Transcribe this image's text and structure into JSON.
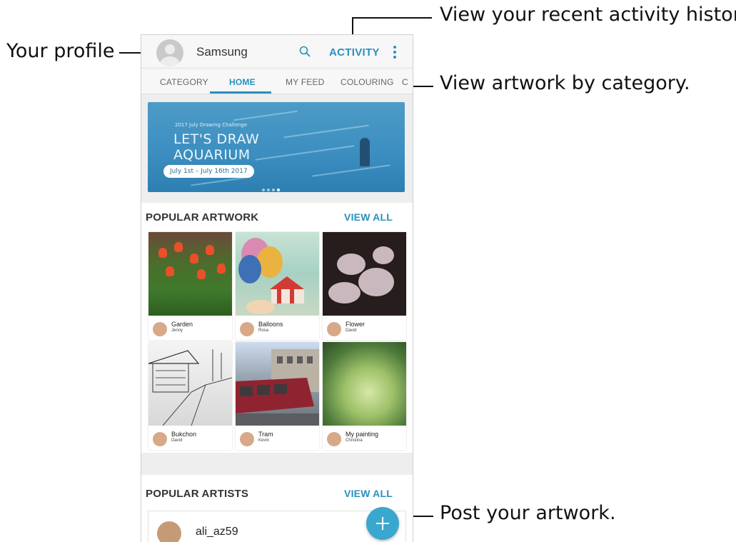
{
  "callouts": {
    "profile": "Your profile",
    "activity": "View your recent activity history.",
    "category": "View artwork by category.",
    "post": "Post your artwork."
  },
  "topbar": {
    "username": "Samsung",
    "activity_label": "ACTIVITY",
    "search_icon": "search-icon",
    "more_icon": "more-vert-icon"
  },
  "tabs": [
    {
      "label": "CATEGORY",
      "active": false
    },
    {
      "label": "HOME",
      "active": true
    },
    {
      "label": "MY FEED",
      "active": false
    },
    {
      "label": "COLOURING",
      "active": false
    },
    {
      "label": "C",
      "active": false
    }
  ],
  "banner": {
    "subtitle": "2017 July Drawing Challenge",
    "title_line1": "LET'S DRAW",
    "title_line2": "AQUARIUM",
    "dates": "July 1st – July 16th 2017",
    "page_count": 4,
    "active_page": 4
  },
  "popular_artwork": {
    "title": "POPULAR ARTWORK",
    "view_all": "VIEW ALL",
    "items": [
      {
        "title": "Garden",
        "artist": "Jenny"
      },
      {
        "title": "Balloons",
        "artist": "Rosa"
      },
      {
        "title": "Flower",
        "artist": "David"
      },
      {
        "title": "Bukchon",
        "artist": "David"
      },
      {
        "title": "Tram",
        "artist": "Kevin"
      },
      {
        "title": "My painting",
        "artist": "Christina"
      }
    ]
  },
  "popular_artists": {
    "title": "POPULAR ARTISTS",
    "view_all": "VIEW ALL",
    "items": [
      {
        "name": "ali_az59"
      }
    ]
  },
  "fab": {
    "icon": "plus-icon"
  },
  "colors": {
    "accent": "#2a8fbd",
    "fab": "#3aa7cf",
    "background": "#eeeeee"
  }
}
